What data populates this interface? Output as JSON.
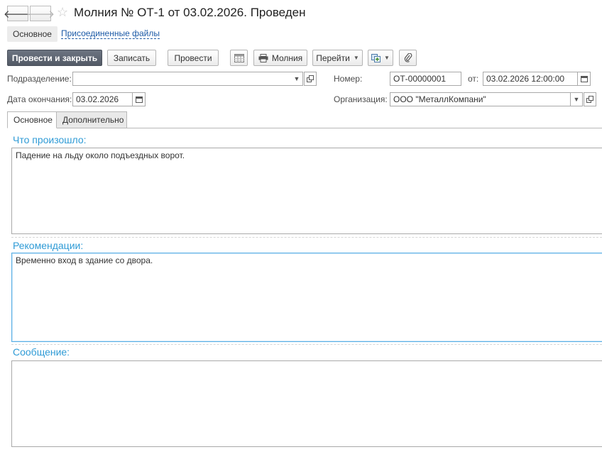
{
  "window": {
    "title": "Молния № ОТ-1 от 03.02.2026. Проведен"
  },
  "sections": {
    "main": "Основное",
    "files": "Присоединенные файлы"
  },
  "toolbar": {
    "post_close": "Провести и закрыть",
    "save": "Записать",
    "post": "Провести",
    "print_label": "Молния",
    "goto": "Перейти"
  },
  "fields": {
    "division_label": "Подразделение:",
    "division_value": "",
    "number_label": "Номер:",
    "number_value": "ОТ-00000001",
    "date_from_label": "от:",
    "date_value": "03.02.2026 12:00:00",
    "end_date_label": "Дата окончания:",
    "end_date_value": "03.02.2026",
    "org_label": "Организация:",
    "org_value": "ООО \"МеталлКомпани\""
  },
  "tabs": [
    {
      "label": "Основное",
      "active": true
    },
    {
      "label": "Дополнительно",
      "active": false
    }
  ],
  "groups": {
    "what_happened_title": "Что произошло:",
    "what_happened_text": "Падение на льду около подъездных ворот.",
    "recommendations_title": "Рекомендации:",
    "recommendations_text": "Временно вход в здание со двора.",
    "message_title": "Сообщение:",
    "message_text": ""
  },
  "colors": {
    "accent_blue": "#2f9bd6",
    "link_blue": "#1c5aa6",
    "primary_button": "#5f6672"
  }
}
